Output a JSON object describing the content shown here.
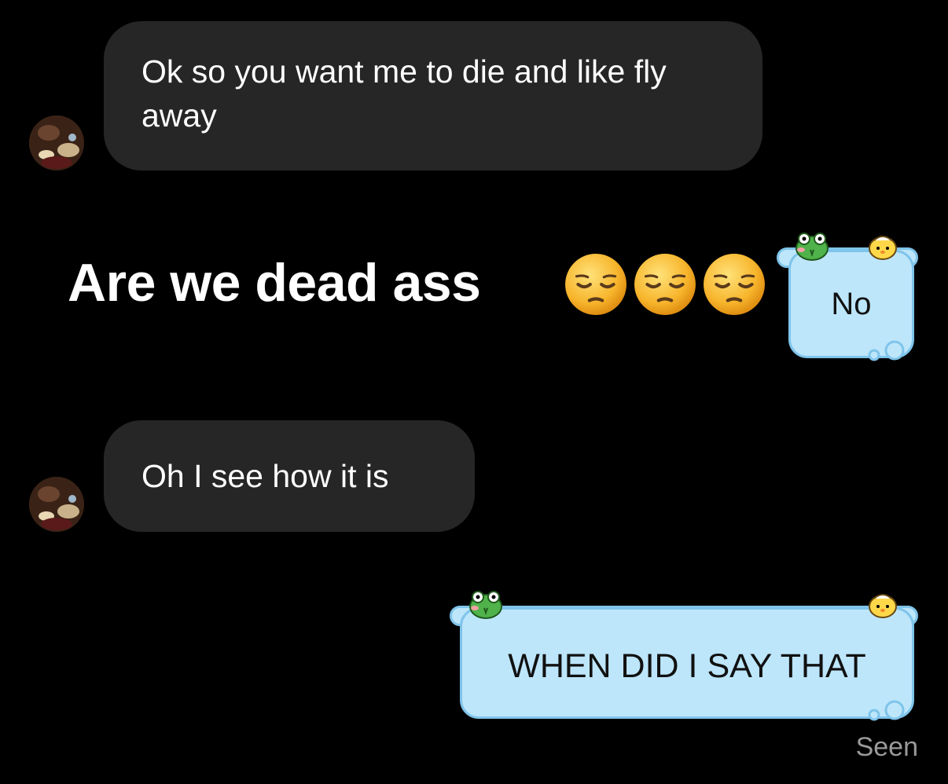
{
  "messages": [
    {
      "sender": "them",
      "text": "Ok so you want me to die and like fly away"
    },
    {
      "sender": "them",
      "text": "Are we dead ass",
      "emoji": "pensive-face",
      "emoji_count": 3
    },
    {
      "sender": "me",
      "text": "No"
    },
    {
      "sender": "them",
      "text": "Oh I see how it is"
    },
    {
      "sender": "me",
      "text": "WHEN DID I SAY THAT"
    }
  ],
  "status": {
    "seen_label": "Seen"
  },
  "colors": {
    "background": "#000000",
    "incoming_bubble": "#262626",
    "outgoing_bubble": "#bde6fb",
    "outgoing_border": "#7fc4ea",
    "seen_text": "#9a9a9a"
  },
  "icons": {
    "avatar": "contact-avatar-photo",
    "emoji": "pensive-face-emoji",
    "bubble_decor_left": "green-frog-sticker",
    "bubble_decor_right": "yellow-chick-sticker"
  }
}
